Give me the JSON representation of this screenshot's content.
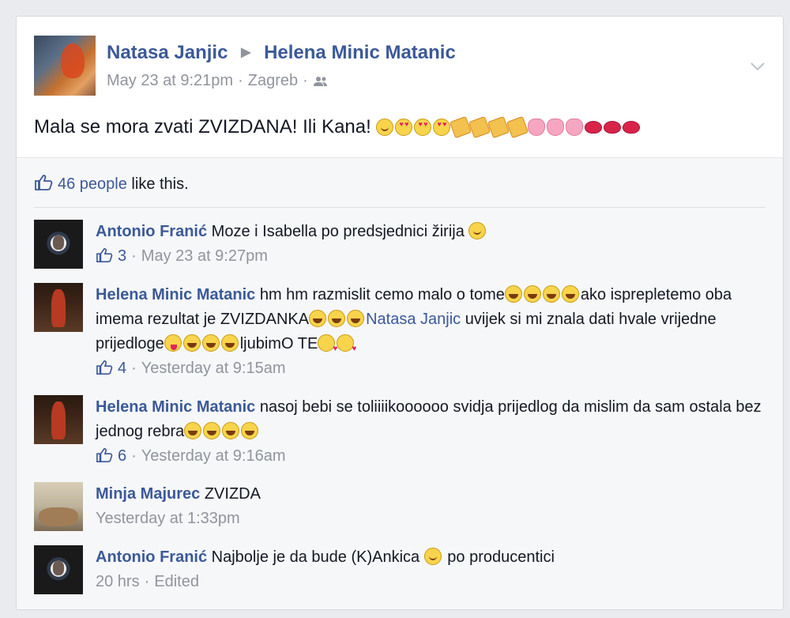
{
  "post": {
    "author": "Natasa Janjic",
    "target": "Helena Minic Matanic",
    "timestamp": "May 23 at 9:21pm",
    "location": "Zagreb",
    "audience_icon": "friends-icon",
    "text": "Mala se mora zvati ZVIZDANA! Ili Kana!",
    "text_emojis": [
      "wink",
      "heart-eyes",
      "heart-eyes",
      "heart-eyes",
      "party",
      "party",
      "party",
      "party",
      "sparkle-heart",
      "sparkle-heart",
      "sparkle-heart",
      "lips",
      "lips",
      "lips"
    ]
  },
  "likes": {
    "count_text": "46 people",
    "suffix": " like this."
  },
  "comments": [
    {
      "author": "Antonio Franić",
      "text": "Moze i Isabella po predsjednici žirija",
      "likes": "3",
      "time": "May 23 at 9:27pm"
    },
    {
      "author": "Helena Minic Matanic",
      "text_part1": "hm hm razmislit cemo malo o tome",
      "text_part2": "ako isprepletemo oba imema rezultat je ZVIZDANKA",
      "mention": "Natasa Janjic",
      "text_part3": " uvijek si mi znala dati hvale vrijedne prijedloge",
      "text_part4": "ljubimO TE",
      "likes": "4",
      "time": "Yesterday at 9:15am"
    },
    {
      "author": "Helena Minic Matanic",
      "text": "nasoj bebi se toliiiikoooooo svidja prijedlog da mislim da sam ostala bez jednog rebra",
      "likes": "6",
      "time": "Yesterday at 9:16am"
    },
    {
      "author": "Minja Majurec",
      "text": "ZVIZDA",
      "time": "Yesterday at 1:33pm"
    },
    {
      "author": "Antonio Franić",
      "text_part1": "Najbolje je da bude (K)Ankica",
      "text_part2": " po producentici",
      "time": "20 hrs",
      "edited": "Edited"
    }
  ],
  "colors": {
    "link": "#3b5998",
    "meta": "#90949c",
    "feedback_bg": "#f6f7f9"
  }
}
